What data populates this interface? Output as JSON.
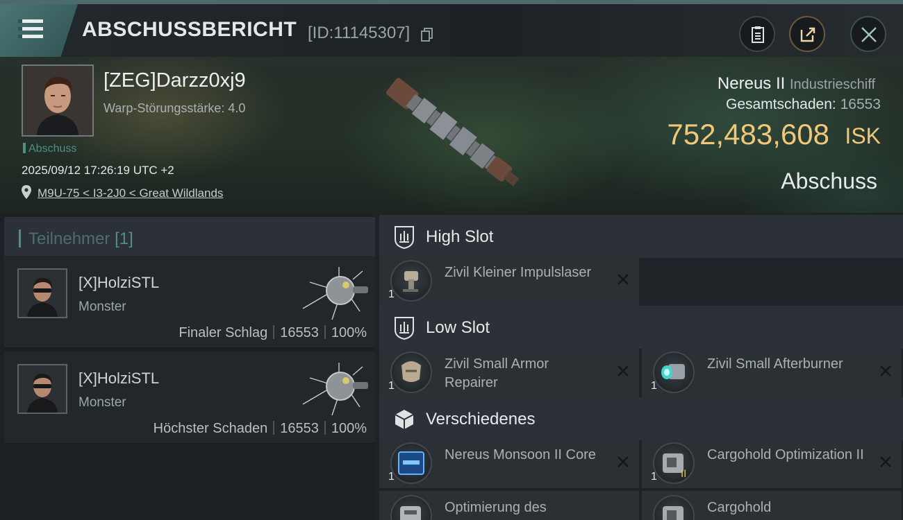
{
  "header": {
    "title": "ABSCHUSSBERICHT",
    "report_id": "[ID:11145307]"
  },
  "victim": {
    "name": "[ZEG]Darzz0xj9",
    "warp_strength": "Warp-Störungsstärke: 4.0",
    "tag": "Abschuss",
    "datetime": "2025/09/12 17:26:19 UTC +2",
    "location": "M9U-75 < I3-2J0 < Great Wildlands",
    "ship_name": "Nereus II",
    "ship_class": "Industrieschiff",
    "total_damage_label": "Gesamtschaden:",
    "total_damage_value": "16553",
    "isk_value": "752,483,608",
    "isk_unit": "ISK",
    "status": "Abschuss"
  },
  "participants": {
    "label": "Teilnehmer",
    "count": "[1]",
    "rows": [
      {
        "name": "[X]HolziSTL",
        "type": "Monster",
        "role": "Finaler Schlag",
        "damage": "16553",
        "percent": "100%"
      },
      {
        "name": "[X]HolziSTL",
        "type": "Monster",
        "role": "Höchster Schaden",
        "damage": "16553",
        "percent": "100%"
      }
    ]
  },
  "fittings": {
    "high_slot": {
      "label": "High Slot",
      "items": [
        {
          "qty": "1",
          "name": "Zivil Kleiner Impulslaser",
          "icon": "laser-icon"
        }
      ]
    },
    "low_slot": {
      "label": "Low Slot",
      "items": [
        {
          "qty": "1",
          "name": "Zivil Small Armor Repairer",
          "icon": "armor-repairer-icon"
        },
        {
          "qty": "1",
          "name": "Zivil Small Afterburner",
          "icon": "afterburner-icon"
        }
      ]
    },
    "misc": {
      "label": "Verschiedenes",
      "items": [
        {
          "qty": "1",
          "name": "Nereus Monsoon II Core",
          "icon": "core-chip-icon"
        },
        {
          "qty": "1",
          "name": "Cargohold Optimization II",
          "icon": "cargohold-icon"
        },
        {
          "qty": "",
          "name": "Optimierung des",
          "icon": "cargo-module-icon"
        },
        {
          "qty": "",
          "name": "Cargohold",
          "icon": "cargohold-icon"
        }
      ]
    }
  },
  "colors": {
    "accent_teal": "#4f8f88",
    "isk_gold": "#f1c87a"
  }
}
